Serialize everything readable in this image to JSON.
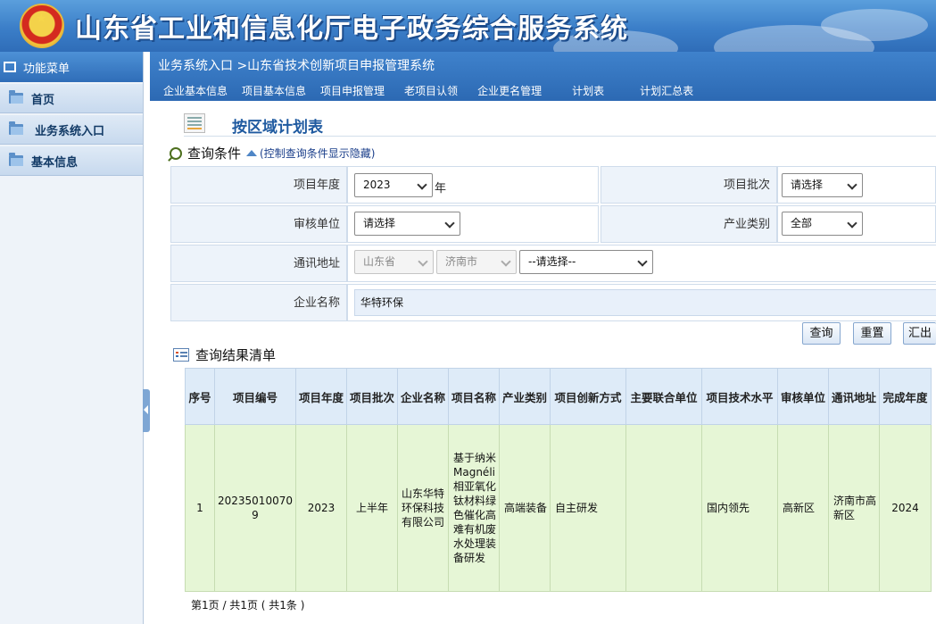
{
  "banner": {
    "title": "山东省工业和信息化厅电子政务综合服务系统"
  },
  "sidebar": {
    "header": "功能菜单",
    "items": [
      {
        "label": "首页"
      },
      {
        "label": "业务系统入口"
      },
      {
        "label": "基本信息"
      }
    ]
  },
  "topnav": {
    "breadcrumb": "业务系统入口 >山东省技术创新项目申报管理系统",
    "menu": [
      "企业基本信息",
      "项目基本信息",
      "项目申报管理",
      "老项目认领",
      "企业更名管理",
      "计划表",
      "计划汇总表"
    ]
  },
  "page": {
    "title": "按区域计划表"
  },
  "query": {
    "header": "查询条件",
    "toggle_label": "(控制查询条件显示隐藏)",
    "fields": {
      "year_label": "项目年度",
      "year_value": "2023",
      "year_unit": "年",
      "batch_label": "项目批次",
      "batch_value": "请选择",
      "audit_label": "审核单位",
      "audit_value": "请选择",
      "industry_label": "产业类别",
      "industry_value": "全部",
      "address_label": "通讯地址",
      "province": "山东省",
      "city": "济南市",
      "district": "--请选择--",
      "company_label": "企业名称",
      "company_value": "华特环保"
    },
    "buttons": {
      "search": "查询",
      "reset": "重置",
      "export": "汇出"
    }
  },
  "results": {
    "header": "查询结果清单",
    "columns": [
      "序号",
      "项目编号",
      "项目年度",
      "项目批次",
      "企业名称",
      "项目名称",
      "产业类别",
      "项目创新方式",
      "主要联合单位",
      "项目技术水平",
      "审核单位",
      "通讯地址",
      "完成年度"
    ],
    "rows": [
      {
        "index": "1",
        "code": "202350100709",
        "year": "2023",
        "batch": "上半年",
        "company": "山东华特环保科技有限公司",
        "project": "基于纳米Magnéli相亚氧化钛材料绿色催化高难有机废水处理装备研发",
        "industry": "高端装备",
        "innovation": "自主研发",
        "partner": "",
        "tech_level": "国内领先",
        "audit_unit": "高新区",
        "address": "济南市高新区",
        "finish_year": "2024"
      }
    ],
    "pager": "第1页 / 共1页 ( 共1条 )"
  }
}
